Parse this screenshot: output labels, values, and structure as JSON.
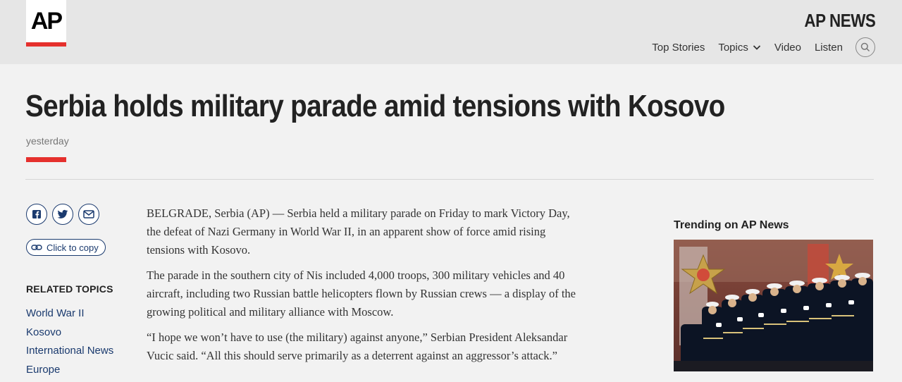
{
  "header": {
    "logo_text": "AP",
    "brand": "AP NEWS",
    "nav": [
      "Top Stories",
      "Topics",
      "Video",
      "Listen"
    ],
    "icons": {
      "search": "search-icon",
      "topics_chevron": "chevron-down-icon"
    }
  },
  "article": {
    "headline": "Serbia holds military parade amid tensions with Kosovo",
    "date": "yesterday",
    "paragraphs": [
      "BELGRADE, Serbia (AP) — Serbia held a military parade on Friday to mark Victory Day, the defeat of Nazi Germany in World War II, in an apparent show of force amid rising tensions with Kosovo.",
      "The parade in the southern city of Nis included 4,000 troops, 300 military vehicles and 40 aircraft, including two Russian battle helicopters flown by Russian crews — a display of the growing political and military alliance with Moscow.",
      "“I hope we won’t have to use (the military) against anyone,” Serbian President Aleksandar Vucic said. “All this should serve primarily as a deterrent against an aggressor’s attack.”"
    ]
  },
  "share": {
    "copy_label": "Click to copy",
    "icons": [
      "facebook-icon",
      "twitter-icon",
      "email-icon",
      "link-icon"
    ]
  },
  "related": {
    "title": "RELATED TOPICS",
    "items": [
      "World War II",
      "Kosovo",
      "International News",
      "Europe"
    ]
  },
  "trending": {
    "title": "Trending on AP News"
  },
  "colors": {
    "accent_red": "#e5302d",
    "link_blue": "#1a3a6e",
    "header_bg": "#e6e6e6",
    "page_bg": "#f2f2f2"
  }
}
